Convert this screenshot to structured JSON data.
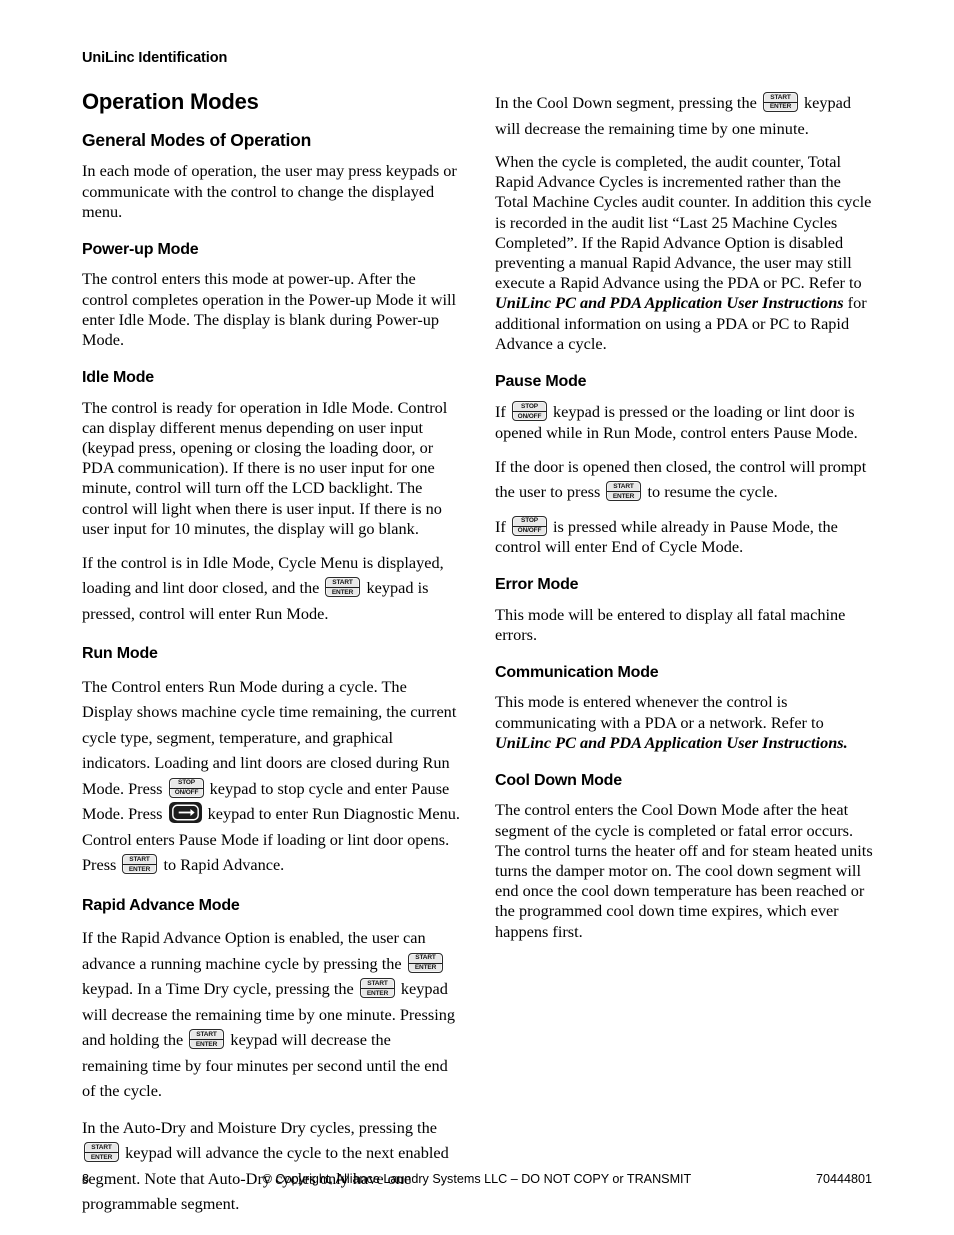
{
  "header": {
    "running_head": "UniLinc Identification"
  },
  "left_column": {
    "title": "Operation Modes",
    "sections": [
      {
        "heading": "General Modes of Operation",
        "level": "sub",
        "paragraphs": [
          "In each mode of operation, the user may press keypads or communicate with the control to change the displayed menu."
        ]
      },
      {
        "heading": "Power-up Mode",
        "level": "mode",
        "paragraphs": [
          "The control enters this mode at power-up. After the control completes operation in the Power-up Mode it will enter Idle Mode. The display is blank during Power-up Mode."
        ]
      },
      {
        "heading": "Idle Mode",
        "level": "mode",
        "paragraphs": [
          "The control is ready for operation in Idle Mode. Control can display different menus depending on user input (keypad press, opening or closing the loading door, or PDA communication). If there is no user input for one minute, control will turn off the LCD backlight. The control will light when there is user input. If there is no user input for 10 minutes, the display will go blank."
        ],
        "idle_run_part1": "If the control is in Idle Mode, Cycle Menu is displayed, loading and lint door closed, and the ",
        "idle_run_part2": " keypad is pressed, control will enter Run Mode."
      },
      {
        "heading": "Run Mode",
        "level": "mode",
        "run_part1": "The Control enters Run Mode during a cycle. The Display shows machine cycle time remaining, the current cycle type, segment, temperature, and graphical indicators. Loading and lint doors are closed during Run Mode. Press ",
        "run_part2": " keypad to stop cycle and enter Pause Mode. Press ",
        "run_part3": " keypad to enter Run Diagnostic Menu. Control enters Pause Mode if loading or lint door opens. Press ",
        "run_part4": " to Rapid Advance."
      },
      {
        "heading": "Rapid Advance Mode",
        "level": "mode",
        "ra_part1": "If the Rapid Advance Option is enabled, the user can advance a running machine cycle by pressing the ",
        "ra_part2": " keypad. In a Time Dry cycle, pressing the ",
        "ra_part3": " keypad will decrease the remaining time by one minute. Pressing and holding the ",
        "ra_part4": " keypad will decrease the remaining time by four minutes per second until the end of the cycle.",
        "ra2_part1": "In the Auto-Dry and Moisture Dry cycles, pressing the ",
        "ra2_part2": " keypad will advance the cycle to the next enabled segment. Note that Auto-Dry cycles only have one programmable segment."
      }
    ]
  },
  "right_column": {
    "cooldown_intro_part1": "In the Cool Down segment, pressing the ",
    "cooldown_intro_part2": " keypad will decrease the remaining time by one minute.",
    "audit_part1": "When the cycle is completed, the audit counter, Total Rapid Advance Cycles is incremented rather than the Total Machine Cycles audit counter. In addition this cycle is recorded in the audit list “Last 25 Machine Cycles Completed”. If the Rapid Advance Option is disabled preventing a manual Rapid Advance, the user may still execute a Rapid Advance using the PDA or PC. Refer to ",
    "audit_reference": "UniLinc PC and PDA Application User Instructions",
    "audit_part2": " for additional information on using a PDA or PC to Rapid Advance a cycle.",
    "sections": [
      {
        "heading": "Pause Mode",
        "pause_p1_part1": "If ",
        "pause_p1_part2": " keypad is pressed or the loading or lint door is opened while in Run Mode, control enters Pause Mode.",
        "pause_p2_part1": "If the door is opened then closed, the control will prompt the user to press ",
        "pause_p2_part2": " to resume the cycle.",
        "pause_p3_part1": "If ",
        "pause_p3_part2": " is pressed while already in Pause Mode, the control will enter End of Cycle Mode."
      },
      {
        "heading": "Error Mode",
        "paragraphs": [
          "This mode will be entered to display all fatal machine errors."
        ]
      },
      {
        "heading": "Communication Mode",
        "comm_part1": "This mode is entered whenever the control is communicating with a PDA or a network. Refer to ",
        "comm_reference": "UniLinc PC and PDA Application User Instructions."
      },
      {
        "heading": "Cool Down Mode",
        "paragraphs": [
          "The control enters the Cool Down Mode after the heat segment of the cycle is completed or fatal error occurs. The control turns the heater off and for steam heated units turns the damper motor on. The cool down segment will end once the cool down temperature has been reached or the programmed cool down time expires, which ever happens first."
        ]
      }
    ]
  },
  "icons": {
    "start_top": "START",
    "start_bottom": "ENTER",
    "stop_top": "STOP",
    "stop_bottom": "ON/OFF",
    "arrow": "right-arrow"
  },
  "footer": {
    "page_number": "8",
    "copyright": "© Copyright, Alliance Laundry Systems LLC – DO NOT COPY or TRANSMIT",
    "document_number": "70444801"
  }
}
